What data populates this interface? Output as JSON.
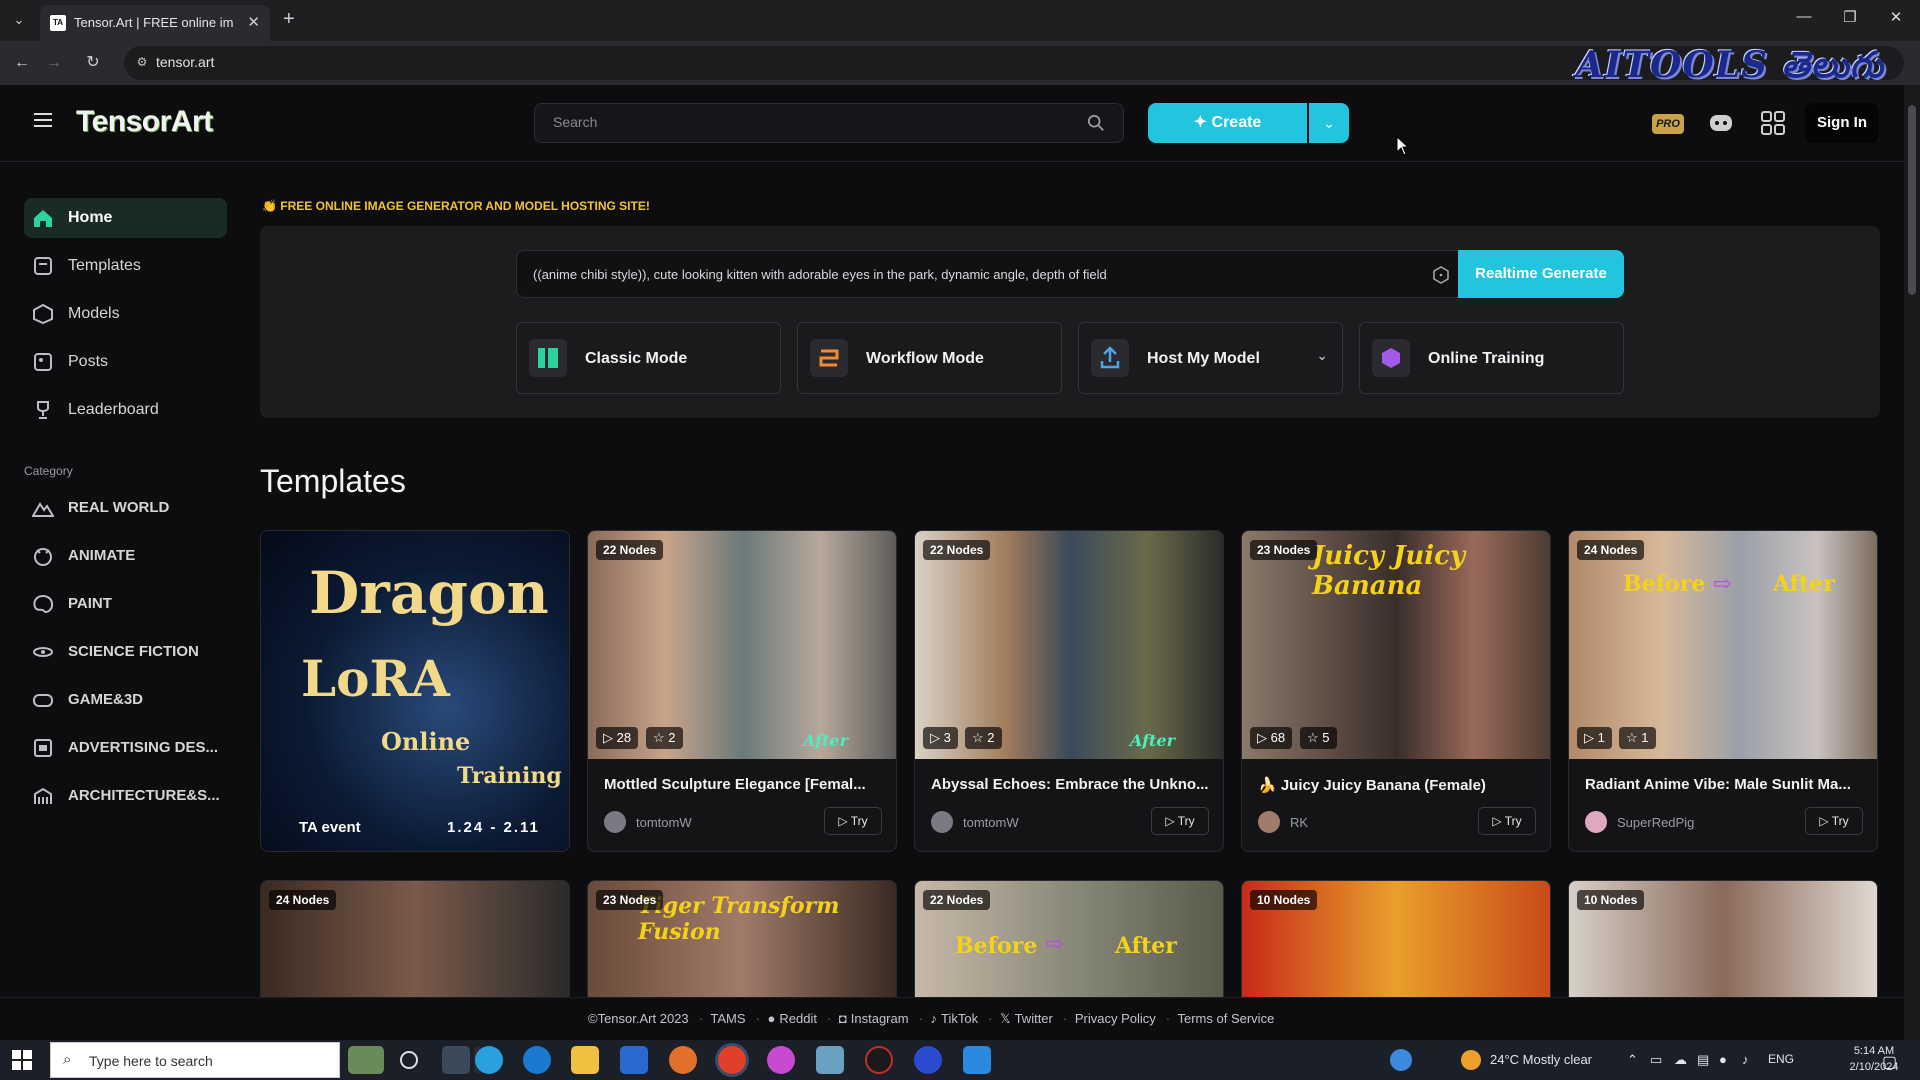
{
  "browser": {
    "tab_title": "Tensor.Art | FREE online image generator",
    "favicon_text": "TA",
    "url": "tensor.art",
    "watermark": "AITOOLS తెలుగు"
  },
  "header": {
    "logo": "TensorArt",
    "search_placeholder": "Search",
    "create_label": "Create",
    "pro_label": "PRO",
    "signin_label": "Sign In"
  },
  "sidebar": {
    "items": [
      {
        "label": "Home",
        "icon": "home-icon"
      },
      {
        "label": "Templates",
        "icon": "templates-icon"
      },
      {
        "label": "Models",
        "icon": "models-icon"
      },
      {
        "label": "Posts",
        "icon": "posts-icon"
      },
      {
        "label": "Leaderboard",
        "icon": "trophy-icon"
      }
    ],
    "category_label": "Category",
    "categories": [
      {
        "label": "REAL WORLD",
        "icon": "mountain-icon"
      },
      {
        "label": "ANIMATE",
        "icon": "animate-icon"
      },
      {
        "label": "PAINT",
        "icon": "palette-icon"
      },
      {
        "label": "SCIENCE FICTION",
        "icon": "atom-icon"
      },
      {
        "label": "GAME&3D",
        "icon": "gamepad-icon"
      },
      {
        "label": "ADVERTISING DES...",
        "icon": "advertising-icon"
      },
      {
        "label": "ARCHITECTURE&S...",
        "icon": "building-icon"
      }
    ]
  },
  "hero": {
    "tagline": "👏 FREE ONLINE IMAGE GENERATOR AND MODEL HOSTING SITE!",
    "prompt": "((anime chibi style)), cute looking kitten with adorable eyes in the park, dynamic angle, depth of field",
    "realtime_label": "Realtime Generate",
    "modes": [
      {
        "label": "Classic Mode",
        "icon": "classic-mode-icon",
        "color": "#2ad4a0"
      },
      {
        "label": "Workflow Mode",
        "icon": "workflow-icon",
        "color": "#f08a3a"
      },
      {
        "label": "Host My Model",
        "icon": "upload-icon",
        "color": "#4aa8e8"
      },
      {
        "label": "Online Training",
        "icon": "cube-icon",
        "color": "#a45ae8"
      }
    ]
  },
  "templates": {
    "title": "Templates",
    "try_label": "Try",
    "row1": [
      {
        "image_text": [
          "Dragon",
          "LoRA",
          "Online",
          "Training",
          "TA event",
          "1.24 - 2.11"
        ]
      },
      {
        "nodes": "22 Nodes",
        "runs": "28",
        "stars": "2",
        "title": "Mottled Sculpture Elegance  [Femal...",
        "author": "tomtomW",
        "after": "After"
      },
      {
        "nodes": "22 Nodes",
        "runs": "3",
        "stars": "2",
        "title": "Abyssal Echoes: Embrace the Unkno...",
        "author": "tomtomW",
        "after": "After"
      },
      {
        "nodes": "23 Nodes",
        "runs": "68",
        "stars": "5",
        "title": "🍌 Juicy Juicy Banana (Female)",
        "author": "RK",
        "banner": "Juicy Juicy Banana"
      },
      {
        "nodes": "24 Nodes",
        "runs": "1",
        "stars": "1",
        "title": "Radiant Anime Vibe: Male Sunlit Ma...",
        "author": "SuperRedPig",
        "before": "Before",
        "after": "After"
      }
    ],
    "row2": [
      {
        "nodes": "24 Nodes"
      },
      {
        "nodes": "23 Nodes",
        "banner": "Tiger Transform Fusion"
      },
      {
        "nodes": "22 Nodes",
        "before": "Before",
        "after": "After"
      },
      {
        "nodes": "10 Nodes"
      },
      {
        "nodes": "10 Nodes"
      }
    ]
  },
  "footer": {
    "copyright": "©Tensor.Art 2023",
    "links": [
      "TAMS",
      "Reddit",
      "Instagram",
      "TikTok",
      "Twitter",
      "Privacy Policy",
      "Terms of Service"
    ]
  },
  "taskbar": {
    "search_placeholder": "Type here to search",
    "weather": "24°C  Mostly clear",
    "lang": "ENG",
    "time": "5:14 AM",
    "date": "2/10/2024"
  }
}
